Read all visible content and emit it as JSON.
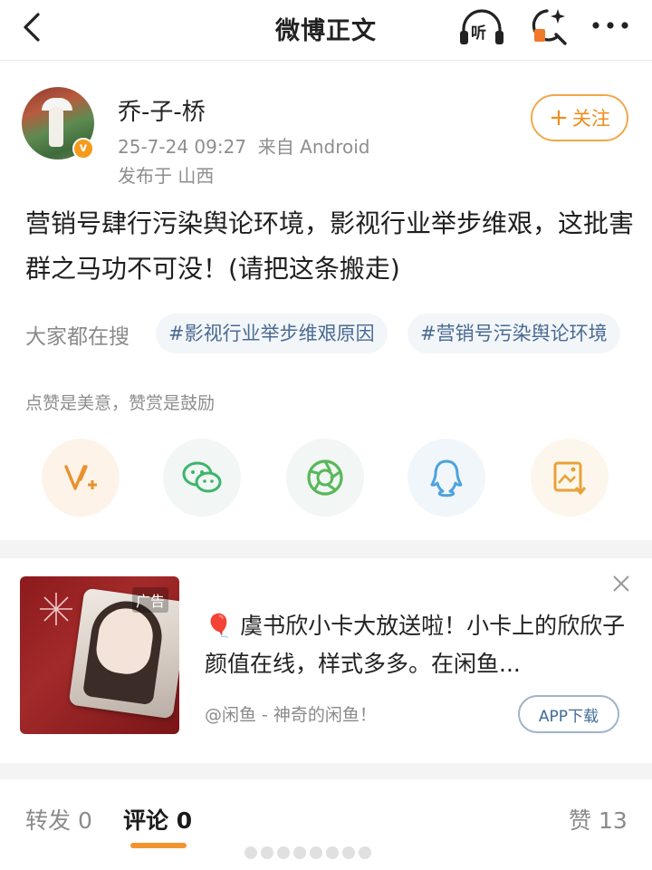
{
  "header": {
    "title": "微博正文",
    "listen_label": "听"
  },
  "post": {
    "username": "乔-子-桥",
    "datetime": "25-7-24 09:27",
    "source": "来自 Android",
    "location": "发布于 山西",
    "follow_label": "关注",
    "follow_plus": "+",
    "text": "营销号肆行污染舆论环境，影视行业举步维艰，这批害群之马功不可没！(请把这条搬走)"
  },
  "trending": {
    "label": "大家都在搜",
    "chips": [
      "#影视行业举步维艰原因",
      "#营销号污染舆论环境"
    ]
  },
  "reward_tip": "点赞是美意，赞赏是鼓励",
  "share_icons": [
    "reward-v-icon",
    "wechat-icon",
    "moments-icon",
    "qq-icon",
    "save-image-icon"
  ],
  "ad": {
    "tag": "广告",
    "text": "🎈 虞书欣小卡大放送啦！小卡上的欣欣子颜值在线，样式多多。在闲鱼...",
    "source": "@闲鱼 - 神奇的闲鱼！",
    "button": "APP下载"
  },
  "tabs": {
    "repost": "转发 0",
    "comment": "评论 0",
    "like": "赞 13"
  },
  "colors": {
    "accent": "#f29430",
    "link_blue": "#4a6a93",
    "gray_text": "#8a8a8a"
  }
}
